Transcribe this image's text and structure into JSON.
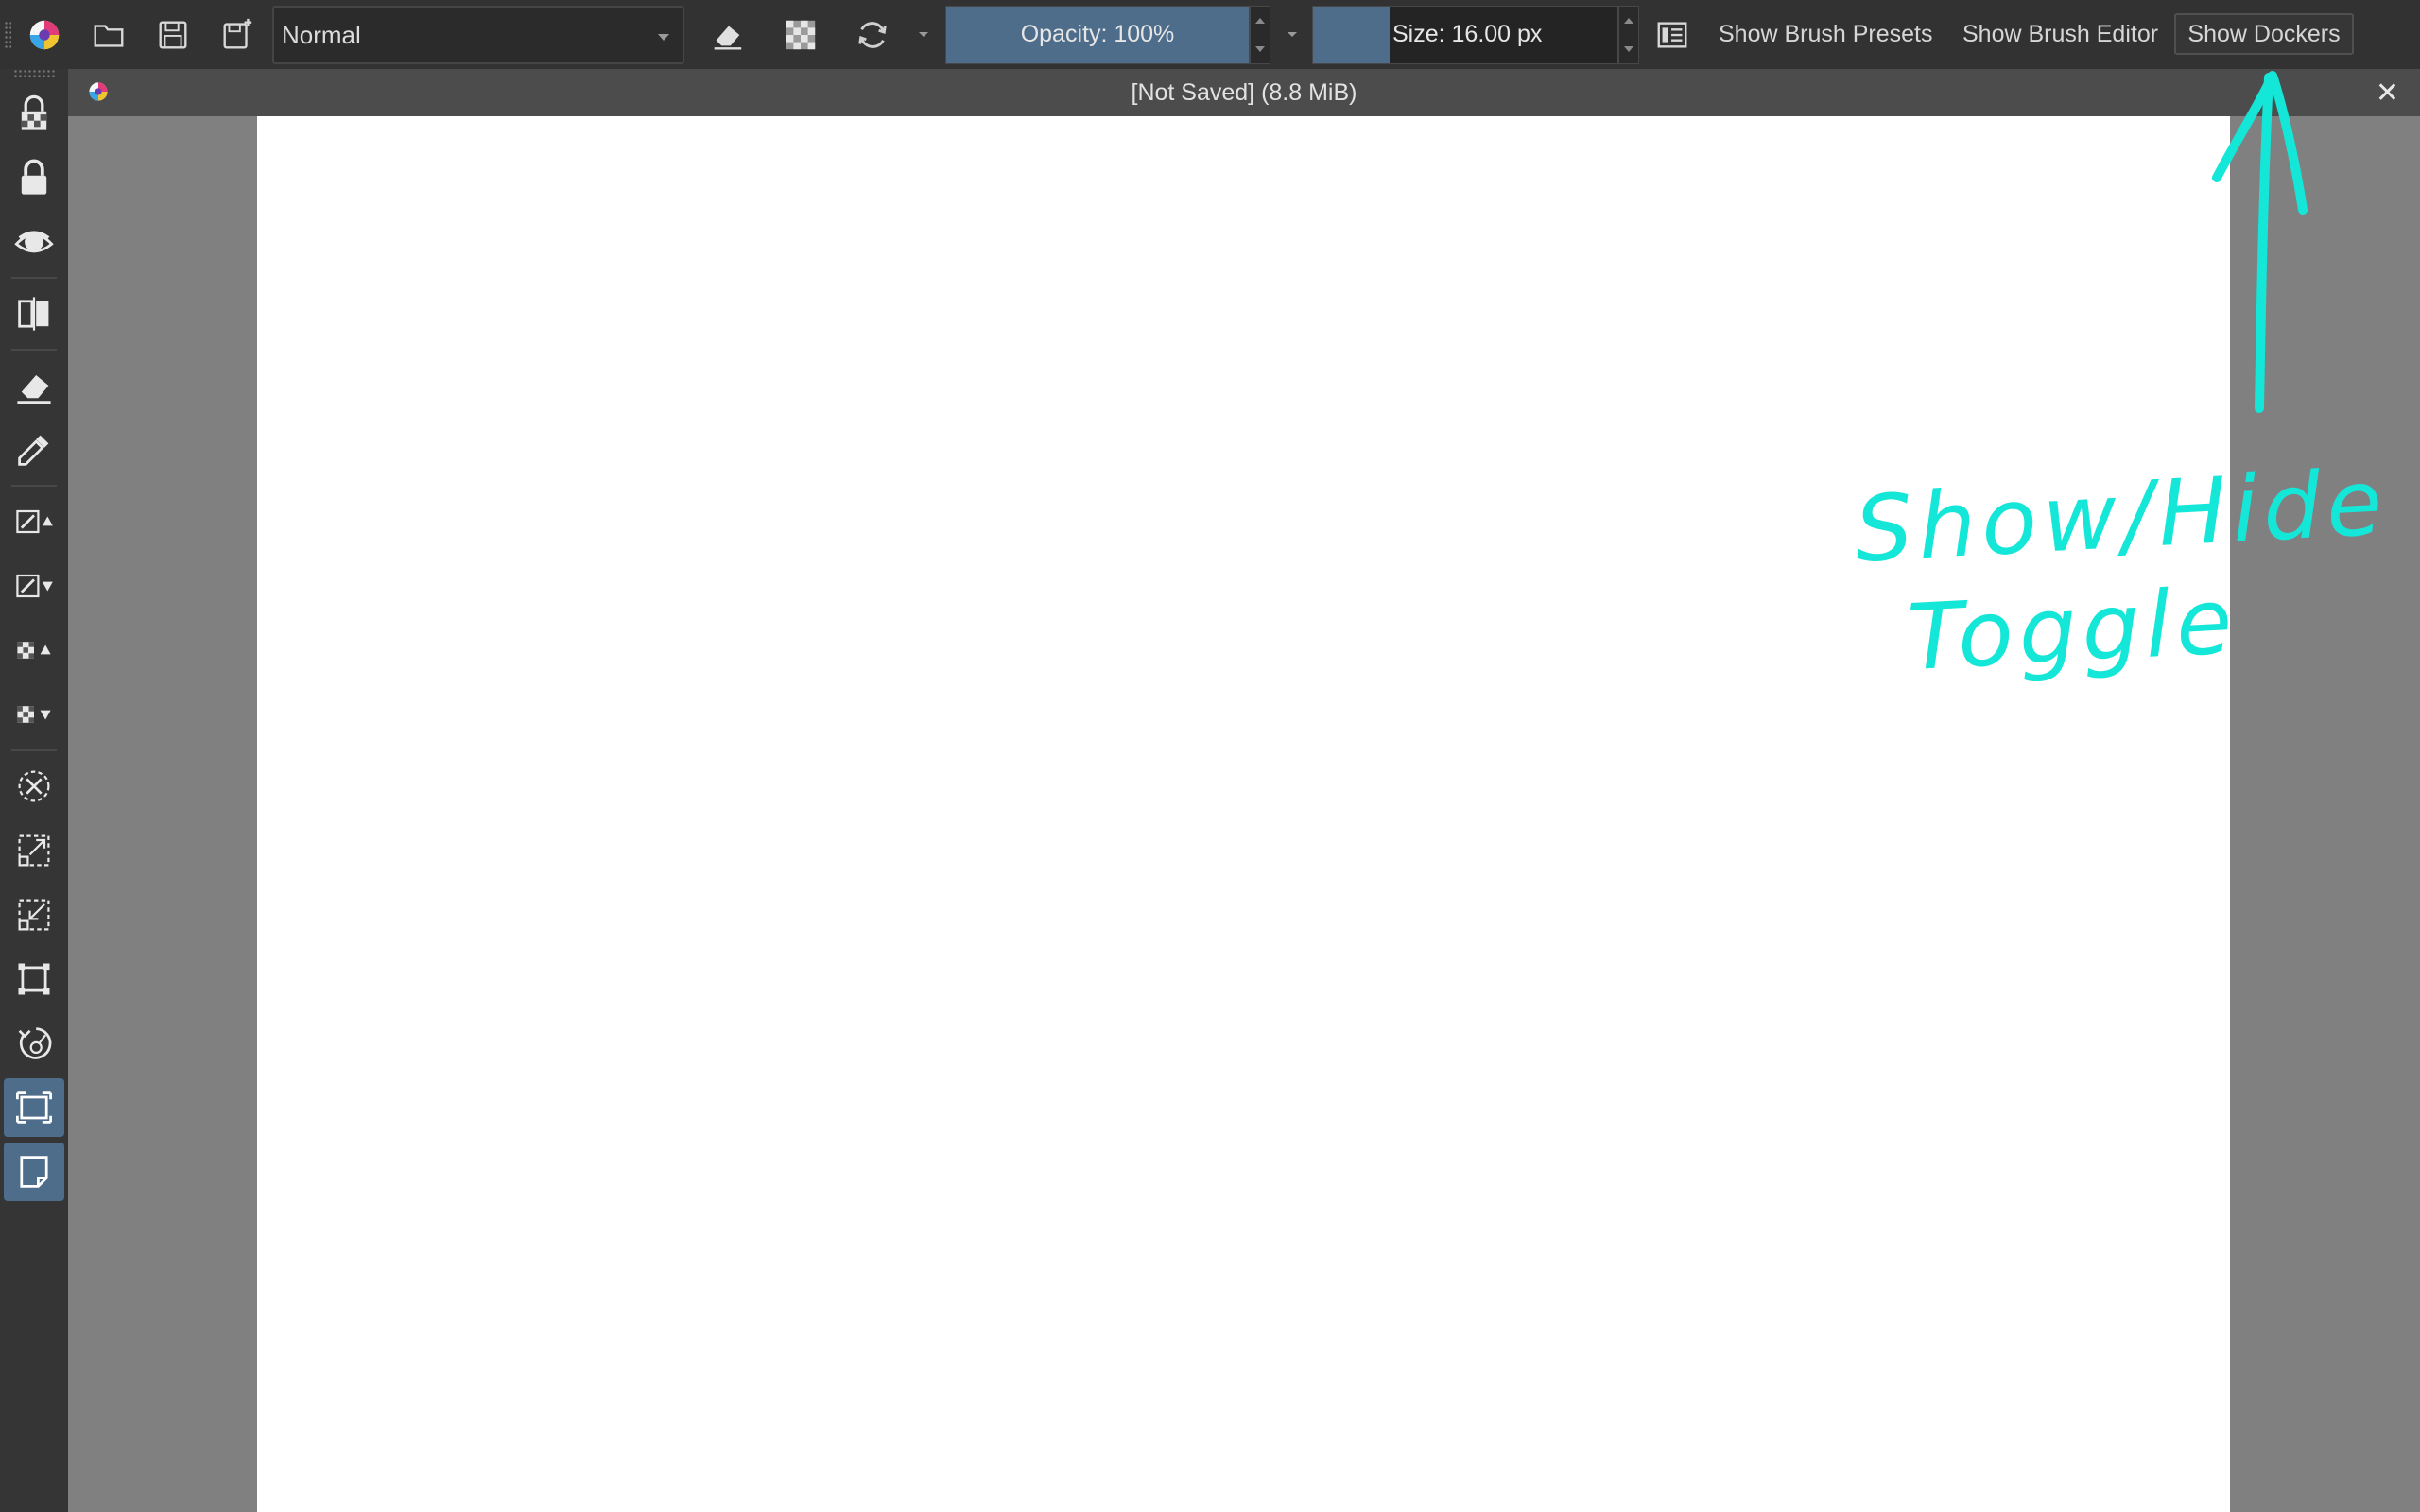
{
  "toolbar": {
    "blend_mode": "Normal",
    "opacity_label": "Opacity: 100%",
    "opacity_value": 1.0,
    "size_label": "Size: 16.00 px",
    "size_fill": 0.25,
    "show_brush_presets": "Show Brush Presets",
    "show_brush_editor": "Show Brush Editor",
    "show_dockers": "Show Dockers",
    "accent_color": "#4e6d8b"
  },
  "document": {
    "title": "[Not Saved]  (8.8 MiB)",
    "close_glyph": "✕"
  },
  "annotation": {
    "line1": "Show/Hide",
    "line2": "Toggle",
    "color": "#14e6d8"
  },
  "icons": {
    "toolbar": [
      "krita-logo-icon",
      "open-folder-icon",
      "save-icon",
      "save-incremental-icon",
      "eraser-mode-icon",
      "alpha-lock-icon",
      "reload-preset-icon",
      "workspace-icon"
    ],
    "toolbox": [
      "lock-alpha-icon",
      "lock-icon",
      "eye-icon",
      "mirror-icon",
      "eraser-icon",
      "color-picker-icon",
      "brush-size-up-icon",
      "brush-size-down-icon",
      "opacity-up-icon",
      "opacity-down-icon",
      "deselect-icon",
      "select-all-icon",
      "fit-icon",
      "crop-icon",
      "rotate-icon",
      "canvas-only-icon",
      "page-icon"
    ]
  }
}
